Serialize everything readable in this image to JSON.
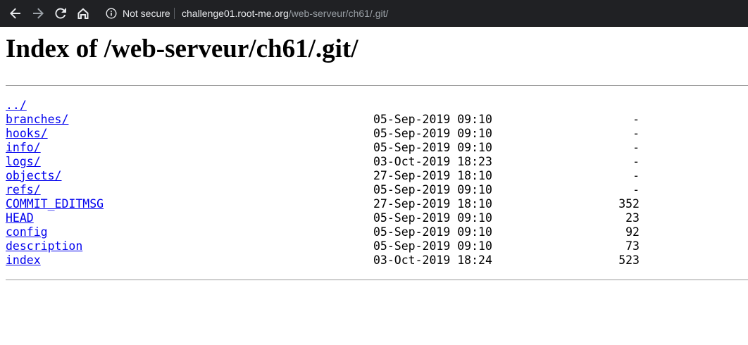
{
  "browser": {
    "security_label": "Not secure",
    "url_host": "challenge01.root-me.org",
    "url_path": "/web-serveur/ch61/.git/"
  },
  "page": {
    "title": "Index of /web-serveur/ch61/.git/",
    "parent_link": "../",
    "entries": [
      {
        "name": "branches/",
        "date": "05-Sep-2019 09:10",
        "size": "-"
      },
      {
        "name": "hooks/",
        "date": "05-Sep-2019 09:10",
        "size": "-"
      },
      {
        "name": "info/",
        "date": "05-Sep-2019 09:10",
        "size": "-"
      },
      {
        "name": "logs/",
        "date": "03-Oct-2019 18:23",
        "size": "-"
      },
      {
        "name": "objects/",
        "date": "27-Sep-2019 18:10",
        "size": "-"
      },
      {
        "name": "refs/",
        "date": "05-Sep-2019 09:10",
        "size": "-"
      },
      {
        "name": "COMMIT_EDITMSG",
        "date": "27-Sep-2019 18:10",
        "size": "352"
      },
      {
        "name": "HEAD",
        "date": "05-Sep-2019 09:10",
        "size": "23"
      },
      {
        "name": "config",
        "date": "05-Sep-2019 09:10",
        "size": "92"
      },
      {
        "name": "description",
        "date": "05-Sep-2019 09:10",
        "size": "73"
      },
      {
        "name": "index",
        "date": "03-Oct-2019 18:24",
        "size": "523"
      }
    ]
  }
}
